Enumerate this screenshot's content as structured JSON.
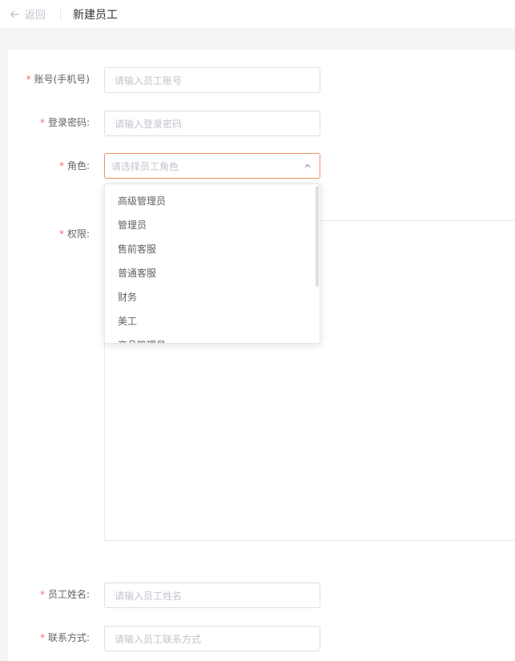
{
  "header": {
    "back_label": "返回",
    "title": "新建员工"
  },
  "form": {
    "account": {
      "label": "账号(手机号)",
      "placeholder": "请输入员工账号"
    },
    "password": {
      "label": "登录密码:",
      "placeholder": "请输入登录密码"
    },
    "role": {
      "label": "角色:",
      "placeholder": "请选择员工角色",
      "options": [
        "高级管理员",
        "管理员",
        "售前客服",
        "普通客服",
        "财务",
        "美工",
        "商品管理员"
      ]
    },
    "permission": {
      "label": "权限:"
    },
    "name": {
      "label": "员工姓名:",
      "placeholder": "请输入员工姓名"
    },
    "contact": {
      "label": "联系方式:",
      "placeholder": "请输入员工联系方式"
    },
    "required_mark": "*"
  },
  "colors": {
    "required": "#f56c6c",
    "focus_border": "#f0906a",
    "placeholder": "#c0c4cc",
    "label": "#606266"
  }
}
